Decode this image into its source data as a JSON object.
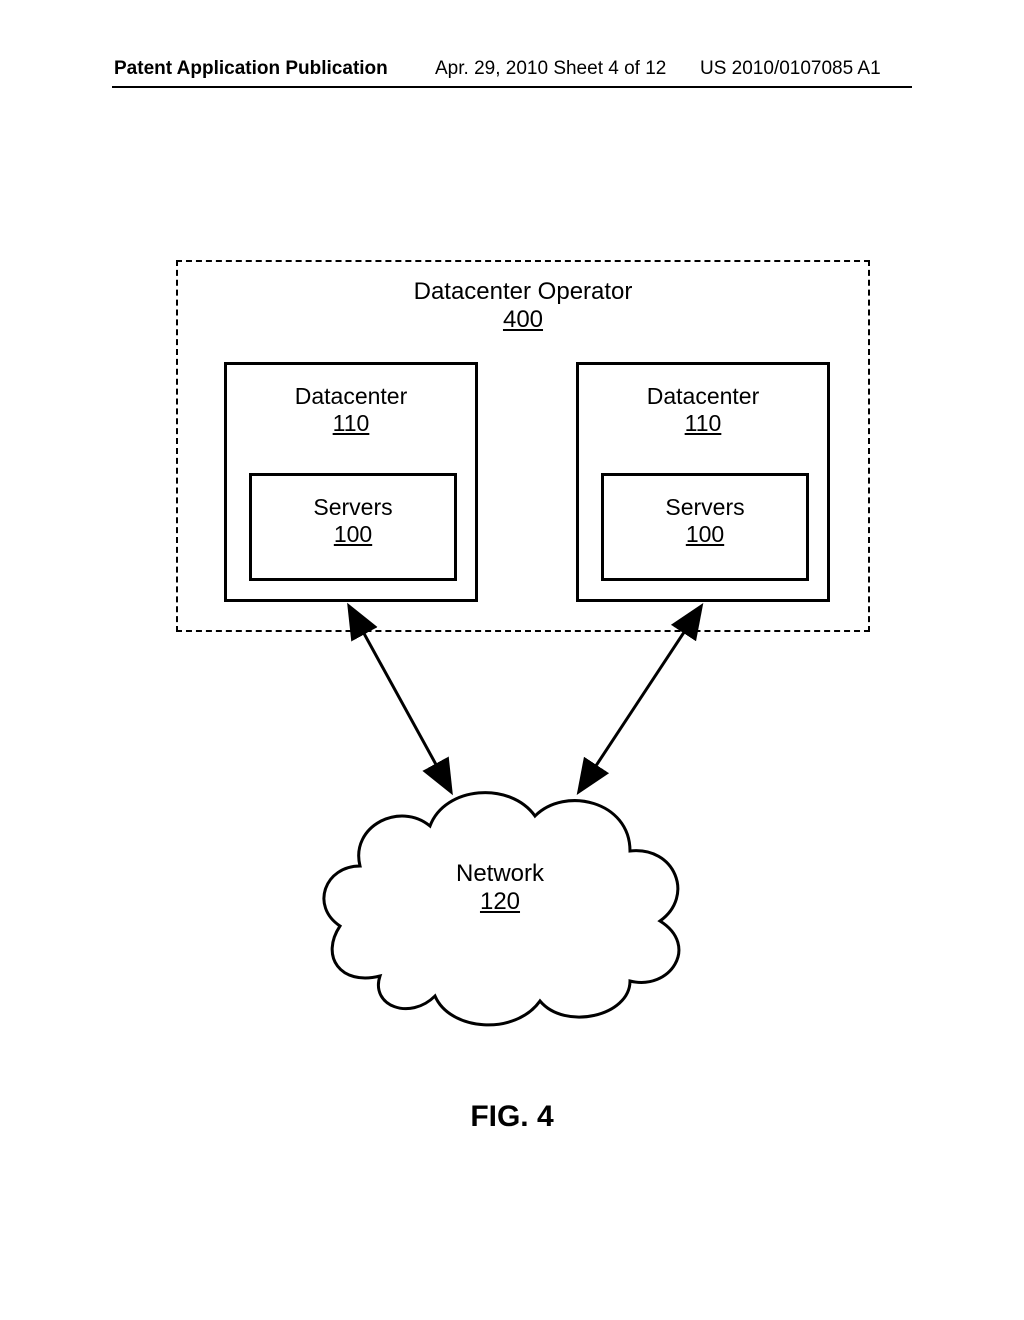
{
  "header": {
    "left": "Patent Application Publication",
    "center": "Apr. 29, 2010  Sheet 4 of 12",
    "right": "US 2010/0107085 A1"
  },
  "operator": {
    "title": "Datacenter Operator",
    "ref": "400"
  },
  "datacenter": {
    "title": "Datacenter",
    "ref": "110"
  },
  "servers": {
    "title": "Servers",
    "ref": "100"
  },
  "network": {
    "title": "Network",
    "ref": "120"
  },
  "figure_caption": "FIG. 4"
}
